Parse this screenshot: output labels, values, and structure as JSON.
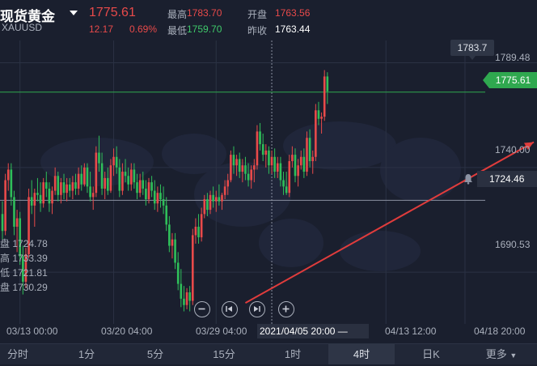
{
  "header": {
    "title": "现货黄金",
    "symbol": "XAUUSD",
    "price": "1775.61",
    "change": "12.17",
    "change_pct": "0.69%",
    "stats": {
      "high_label": "最高",
      "high": "1783.70",
      "open_label": "开盘",
      "open": "1763.56",
      "low_label": "最低",
      "low": "1759.70",
      "prev_label": "昨收",
      "prev": "1763.44"
    }
  },
  "ohlc_panel": [
    {
      "label": "盘",
      "value": "1724.78"
    },
    {
      "label": "高",
      "value": "1733.39"
    },
    {
      "label": "低",
      "value": "1721.81"
    },
    {
      "label": "盘",
      "value": "1730.29"
    }
  ],
  "price_tags": {
    "last": "1775.61",
    "alert": "1724.46",
    "high_bubble": "1783.7"
  },
  "cursor_time": "2021/04/05 20:00",
  "nav_buttons": [
    "zoom-out",
    "prev",
    "next",
    "zoom-in"
  ],
  "timeframes": [
    {
      "label": "分时",
      "active": false
    },
    {
      "label": "1分",
      "active": false
    },
    {
      "label": "5分",
      "active": false
    },
    {
      "label": "15分",
      "active": false
    },
    {
      "label": "1时",
      "active": false
    },
    {
      "label": "4时",
      "active": true
    },
    {
      "label": "日K",
      "active": false
    },
    {
      "label": "更多",
      "active": false
    }
  ],
  "colors": {
    "up": "#e84a4a",
    "down": "#2fbf5a",
    "background": "#1a1f2e",
    "trend_line": "#e03c3c"
  },
  "chart_data": {
    "type": "candlestick",
    "y_ticks": [
      "1789.48",
      "1740.00",
      "1690.53"
    ],
    "ylim": [
      1668,
      1800
    ],
    "x_ticks": [
      "03/13 00:00",
      "03/20 04:00",
      "03/29 04:00",
      "04/13 12:00",
      "04/18 20:00"
    ],
    "x_tick_index": [
      6,
      38,
      73,
      131,
      158
    ],
    "cursor_index": 92,
    "horizontal_lines": [
      1775.61,
      1724.46
    ],
    "trendline": {
      "from": [
        83,
        1676
      ],
      "to": [
        163,
        1752
      ]
    },
    "candles": [
      [
        1718,
        1724,
        1706,
        1710
      ],
      [
        1710,
        1737,
        1708,
        1734
      ],
      [
        1734,
        1742,
        1729,
        1739
      ],
      [
        1739,
        1742,
        1722,
        1726
      ],
      [
        1726,
        1729,
        1708,
        1712
      ],
      [
        1712,
        1720,
        1700,
        1716
      ],
      [
        1716,
        1719,
        1694,
        1698
      ],
      [
        1698,
        1703,
        1680,
        1686
      ],
      [
        1686,
        1702,
        1683,
        1699
      ],
      [
        1699,
        1730,
        1697,
        1726
      ],
      [
        1726,
        1734,
        1718,
        1722
      ],
      [
        1722,
        1730,
        1712,
        1728
      ],
      [
        1728,
        1735,
        1724,
        1727
      ],
      [
        1727,
        1733,
        1719,
        1723
      ],
      [
        1723,
        1735,
        1721,
        1733
      ],
      [
        1733,
        1738,
        1726,
        1730
      ],
      [
        1730,
        1733,
        1719,
        1723
      ],
      [
        1723,
        1731,
        1718,
        1729
      ],
      [
        1729,
        1740,
        1727,
        1736
      ],
      [
        1736,
        1738,
        1724,
        1727
      ],
      [
        1727,
        1735,
        1723,
        1733
      ],
      [
        1733,
        1737,
        1725,
        1728
      ],
      [
        1728,
        1735,
        1724,
        1732
      ],
      [
        1732,
        1735,
        1726,
        1729
      ],
      [
        1729,
        1736,
        1725,
        1733
      ],
      [
        1733,
        1737,
        1727,
        1730
      ],
      [
        1730,
        1740,
        1727,
        1737
      ],
      [
        1737,
        1741,
        1729,
        1732
      ],
      [
        1732,
        1742,
        1731,
        1740
      ],
      [
        1740,
        1742,
        1728,
        1731
      ],
      [
        1731,
        1738,
        1724,
        1726
      ],
      [
        1726,
        1731,
        1720,
        1728
      ],
      [
        1728,
        1750,
        1726,
        1747
      ],
      [
        1747,
        1755,
        1738,
        1742
      ],
      [
        1742,
        1747,
        1727,
        1730
      ],
      [
        1730,
        1738,
        1725,
        1735
      ],
      [
        1735,
        1740,
        1727,
        1729
      ],
      [
        1729,
        1744,
        1728,
        1741
      ],
      [
        1741,
        1749,
        1736,
        1745
      ],
      [
        1745,
        1750,
        1737,
        1740
      ],
      [
        1740,
        1744,
        1726,
        1729
      ],
      [
        1729,
        1742,
        1727,
        1738
      ],
      [
        1738,
        1744,
        1733,
        1736
      ],
      [
        1736,
        1740,
        1729,
        1732
      ],
      [
        1732,
        1742,
        1729,
        1739
      ],
      [
        1739,
        1742,
        1730,
        1733
      ],
      [
        1733,
        1737,
        1725,
        1728
      ],
      [
        1728,
        1737,
        1726,
        1734
      ],
      [
        1734,
        1738,
        1727,
        1730
      ],
      [
        1730,
        1734,
        1722,
        1725
      ],
      [
        1725,
        1735,
        1723,
        1733
      ],
      [
        1733,
        1736,
        1726,
        1729
      ],
      [
        1729,
        1734,
        1720,
        1723
      ],
      [
        1723,
        1731,
        1719,
        1728
      ],
      [
        1728,
        1732,
        1721,
        1725
      ],
      [
        1725,
        1731,
        1718,
        1722
      ],
      [
        1722,
        1726,
        1710,
        1713
      ],
      [
        1713,
        1717,
        1700,
        1703
      ],
      [
        1703,
        1709,
        1697,
        1706
      ],
      [
        1706,
        1709,
        1692,
        1695
      ],
      [
        1695,
        1700,
        1682,
        1685
      ],
      [
        1685,
        1692,
        1674,
        1678
      ],
      [
        1678,
        1684,
        1672,
        1675
      ],
      [
        1675,
        1683,
        1673,
        1681
      ],
      [
        1681,
        1684,
        1672,
        1677
      ],
      [
        1677,
        1711,
        1675,
        1708
      ],
      [
        1708,
        1716,
        1704,
        1712
      ],
      [
        1712,
        1718,
        1704,
        1707
      ],
      [
        1707,
        1721,
        1705,
        1718
      ],
      [
        1718,
        1727,
        1716,
        1725
      ],
      [
        1725,
        1728,
        1717,
        1720
      ],
      [
        1720,
        1729,
        1718,
        1727
      ],
      [
        1727,
        1731,
        1721,
        1724
      ],
      [
        1724,
        1729,
        1719,
        1726
      ],
      [
        1726,
        1732,
        1722,
        1724
      ],
      [
        1724,
        1728,
        1720,
        1727
      ],
      [
        1727,
        1734,
        1725,
        1731
      ],
      [
        1731,
        1737,
        1727,
        1734
      ],
      [
        1734,
        1748,
        1733,
        1746
      ],
      [
        1746,
        1750,
        1737,
        1741
      ],
      [
        1741,
        1746,
        1736,
        1744
      ],
      [
        1744,
        1747,
        1735,
        1738
      ],
      [
        1738,
        1744,
        1733,
        1741
      ],
      [
        1741,
        1745,
        1734,
        1737
      ],
      [
        1737,
        1742,
        1731,
        1734
      ],
      [
        1734,
        1741,
        1730,
        1739
      ],
      [
        1739,
        1744,
        1733,
        1741
      ],
      [
        1741,
        1760,
        1739,
        1757
      ],
      [
        1757,
        1761,
        1748,
        1751
      ],
      [
        1751,
        1756,
        1743,
        1746
      ],
      [
        1746,
        1751,
        1740,
        1748
      ],
      [
        1748,
        1750,
        1737,
        1741
      ],
      [
        1741,
        1748,
        1737,
        1745
      ],
      [
        1745,
        1749,
        1735,
        1738
      ],
      [
        1738,
        1745,
        1735,
        1742
      ],
      [
        1742,
        1745,
        1731,
        1734
      ],
      [
        1734,
        1738,
        1727,
        1731
      ],
      [
        1731,
        1738,
        1727,
        1728
      ],
      [
        1728,
        1746,
        1726,
        1743
      ],
      [
        1743,
        1750,
        1740,
        1746
      ],
      [
        1746,
        1749,
        1733,
        1736
      ],
      [
        1736,
        1744,
        1731,
        1741
      ],
      [
        1741,
        1748,
        1739,
        1745
      ],
      [
        1745,
        1749,
        1735,
        1738
      ],
      [
        1738,
        1757,
        1736,
        1754
      ],
      [
        1754,
        1758,
        1740,
        1743
      ],
      [
        1743,
        1748,
        1737,
        1745
      ],
      [
        1745,
        1770,
        1743,
        1767
      ],
      [
        1767,
        1771,
        1760,
        1763
      ],
      [
        1763,
        1766,
        1756,
        1764
      ],
      [
        1764,
        1786,
        1762,
        1783
      ],
      [
        1783,
        1785,
        1770,
        1776
      ]
    ]
  }
}
